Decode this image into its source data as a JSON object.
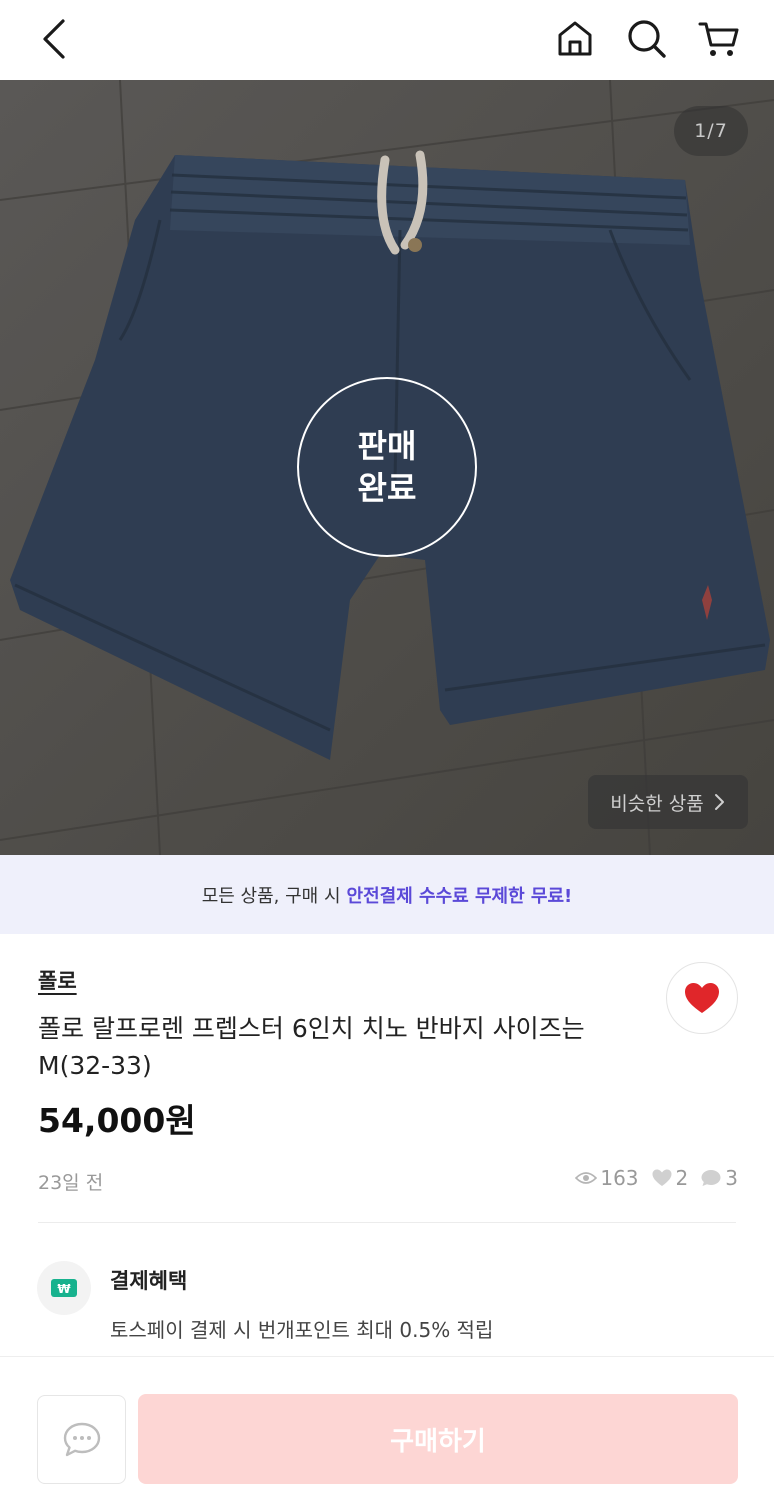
{
  "header": {
    "back_icon": "chevron-left-icon",
    "home_icon": "home-icon",
    "search_icon": "search-icon",
    "cart_icon": "cart-icon"
  },
  "gallery": {
    "counter": "1/7",
    "sold_line1": "판매",
    "sold_line2": "완료",
    "similar_label": "비슷한 상품",
    "similar_icon": "chevron-right-icon"
  },
  "banner": {
    "text": "모든 상품, 구매 시",
    "highlight": "안전결제 수수료 무제한 무료!",
    "highlight_color": "#5b49d8"
  },
  "product": {
    "brand": "폴로",
    "title": "폴로 랄프로렌 프렙스터 6인치 치노 반바지 사이즈는 M(32-33)",
    "price": "54,000원",
    "posted": "23일 전",
    "views": "163",
    "likes": "2",
    "chats": "3",
    "like_color": "#e0262a"
  },
  "benefit": {
    "title": "결제혜택",
    "description": "토스페이 결제 시 번개포인트 최대 0.5% 적립"
  },
  "bottom": {
    "chat_icon": "chat-bubble-icon",
    "buy_label": "구매하기",
    "buy_color": "#fdd6d4"
  }
}
